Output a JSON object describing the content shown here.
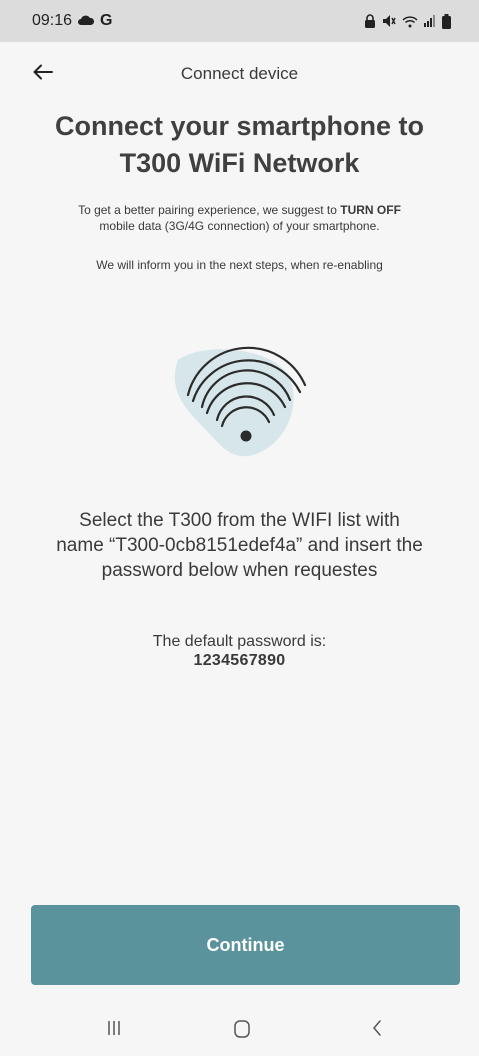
{
  "status_bar": {
    "time": "09:16",
    "left_icons": [
      "cloud-icon",
      "google-icon"
    ],
    "right_icons": [
      "lock-icon",
      "mute-icon",
      "wifi-icon",
      "signal-icon",
      "battery-icon"
    ]
  },
  "header": {
    "back_icon": "arrow-left-icon",
    "title": "Connect device"
  },
  "main": {
    "title_line1": "Connect your smartphone to",
    "title_line2": "T300 WiFi Network",
    "info_prefix": "To get a better pairing experience, we suggest to ",
    "info_emphasis": "TURN OFF",
    "info_line2": "mobile data (3G/4G connection) of your smartphone.",
    "info_followup": "We will inform you in the next steps, when re-enabling",
    "illustration_icon": "wifi-icon",
    "select_line1": "Select the T300 from the WIFI list with",
    "select_line2": "name “T300-0cb8151edef4a” and insert the",
    "select_line3": "password below when requestes",
    "password_label": "The default password is:",
    "password_value": "1234567890"
  },
  "actions": {
    "continue_label": "Continue"
  },
  "nav_bar": {
    "icons": [
      "recent-apps-icon",
      "home-icon",
      "back-icon"
    ]
  },
  "colors": {
    "primary_button": "#5a939b",
    "illustration_blob": "#d6e6ea",
    "background": "#f6f6f6",
    "status_bar": "#dcdcdc"
  }
}
